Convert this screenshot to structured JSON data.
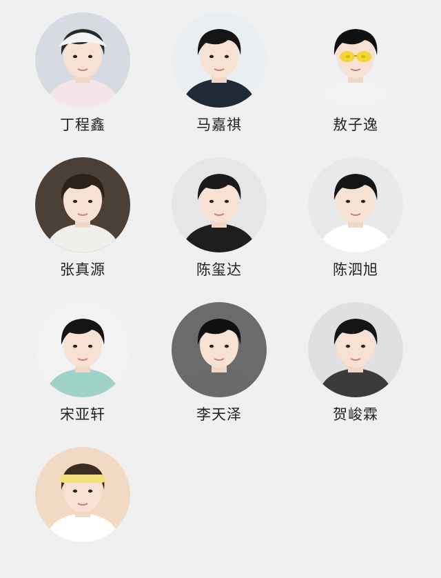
{
  "people": [
    {
      "name": "丁程鑫",
      "bg": "#d6dbe1",
      "hair": "#2a2a2a",
      "shirt": "#f4e6e8",
      "hat": true
    },
    {
      "name": "马嘉祺",
      "bg": "#e9eef2",
      "hair": "#141414",
      "shirt": "#1f2a36"
    },
    {
      "name": "敖子逸",
      "bg": "#eef0f2",
      "hair": "#101010",
      "shirt": "#f2f2f2",
      "glasses": true
    },
    {
      "name": "张真源",
      "bg": "#4a4038",
      "hair": "#2b2118",
      "shirt": "#f1efe9"
    },
    {
      "name": "陈玺达",
      "bg": "#e6e6e6",
      "hair": "#1a1a1a",
      "shirt": "#1e1e1e"
    },
    {
      "name": "陈泗旭",
      "bg": "#e9e9e9",
      "hair": "#151515",
      "shirt": "#ffffff"
    },
    {
      "name": "宋亚轩",
      "bg": "#f2f2f2",
      "hair": "#141414",
      "shirt": "#9fd3c8"
    },
    {
      "name": "李天泽",
      "bg": "#6b6b6b",
      "hair": "#101010",
      "shirt": "#6a6a6a"
    },
    {
      "name": "贺峻霖",
      "bg": "#e0e0e2",
      "hair": "#141414",
      "shirt": "#3b3b3b"
    },
    {
      "name": "",
      "bg": "#f2d9c3",
      "hair": "#3a2c22",
      "shirt": "#ffffff",
      "headband": true
    }
  ]
}
